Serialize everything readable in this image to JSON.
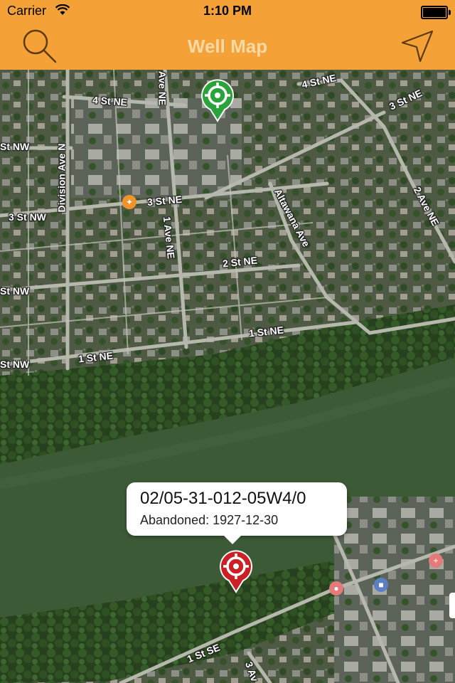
{
  "status_bar": {
    "carrier": "Carrier",
    "time": "1:10 PM"
  },
  "nav": {
    "title": "Well Map",
    "search_icon": "search-icon",
    "locate_icon": "location-arrow-icon"
  },
  "map": {
    "streets": [
      {
        "id": "4st-ne-a",
        "label": "4 St NE"
      },
      {
        "id": "4st-ne-b",
        "label": "4 St NE"
      },
      {
        "id": "3st-ne-a",
        "label": "3 St NE"
      },
      {
        "id": "3st-ne-b",
        "label": "3 St NE"
      },
      {
        "id": "3st-nw",
        "label": "3 St NW"
      },
      {
        "id": "st-nw-a",
        "label": "St NW"
      },
      {
        "id": "st-nw-b",
        "label": "St NW"
      },
      {
        "id": "st-nw-c",
        "label": "St NW"
      },
      {
        "id": "2st-ne",
        "label": "2 St NE"
      },
      {
        "id": "1st-ne-a",
        "label": "1 St NE"
      },
      {
        "id": "1st-ne-b",
        "label": "1 St NE"
      },
      {
        "id": "1st-se",
        "label": "1 St SE"
      },
      {
        "id": "division-ave",
        "label": "Division Ave N"
      },
      {
        "id": "ave-ne-top",
        "label": "Ave NE"
      },
      {
        "id": "1ave-ne",
        "label": "1 Ave NE"
      },
      {
        "id": "altawana-ave",
        "label": "Altawana Ave"
      },
      {
        "id": "2ave-ne",
        "label": "2 Ave NE"
      },
      {
        "id": "3ave",
        "label": "3 Av"
      }
    ],
    "pins": [
      {
        "id": "well-green",
        "color": "#2aa33a",
        "selected": false
      },
      {
        "id": "well-red",
        "color": "#cc2027",
        "selected": true
      }
    ],
    "callout": {
      "well_id": "02/05-31-012-05W4/0",
      "status": "Abandoned: 1927-12-30"
    },
    "colors": {
      "river": "#3c5936",
      "urban": "#4e5a45",
      "road": "#b7b8ad",
      "trees": "#2c4a22"
    }
  }
}
